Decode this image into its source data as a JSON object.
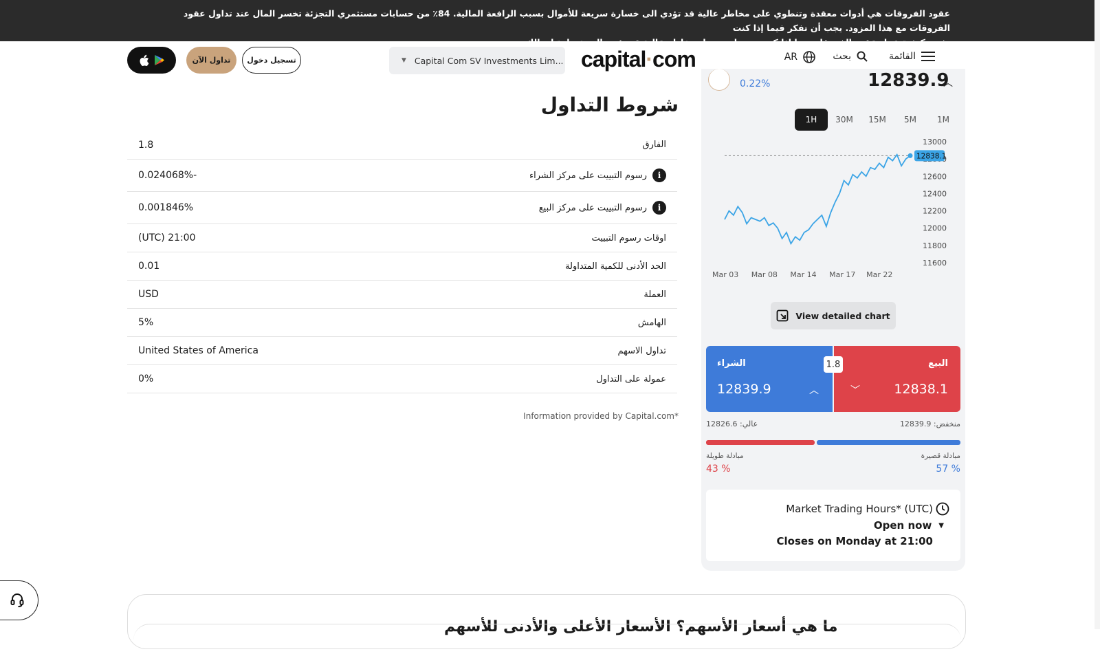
{
  "risk_banner": {
    "line1": "عقود الفروقات هي أدوات معقدة وتنطوي على مخاطر عالية قد تؤدي الى خسارة سريعة للأموال بسبب الرافعة المالية. 84٪ من حسابات مستثمري التجزئة تخسر المال عند تداول عقود الفروقات مع هذا المزود. يجب أن تفكر فيما إذا كنت",
    "line2": "تفهم كيفية عمل عقود الفروقات وما إذا كنت تستطيع تحمل مخاطر عالية قد تؤدي الى خسارة اموالك."
  },
  "nav": {
    "menu_label": "القائمة",
    "search_label": "بحث",
    "lang_label": "AR",
    "logo_left": "capital",
    "logo_dot": "·",
    "logo_right": "com",
    "entity_select": "Capital Com SV Investments Lim...",
    "login_label": "تسجيل دخول",
    "trade_now_label": "تداول الآن"
  },
  "terms": {
    "title": "شروط التداول",
    "rows": [
      {
        "label": "الفارق",
        "value": "1.8",
        "info": false
      },
      {
        "label": "رسوم التبييت على مركز الشراء",
        "value": "0.024068%-",
        "info": true
      },
      {
        "label": "رسوم التبييت على مركز البيع",
        "value": "0.001846%",
        "info": true
      },
      {
        "label": "اوقات رسوم التبييت",
        "value": "(UTC) 21:00",
        "info": false
      },
      {
        "label": "الحد الأدنى للكمية المتداولة",
        "value": "0.01",
        "info": false
      },
      {
        "label": "العملة",
        "value": "USD",
        "info": false
      },
      {
        "label": "الهامش",
        "value": "5%",
        "info": false
      },
      {
        "label": "تداول الاسهم",
        "value": "United States of America",
        "info": false
      },
      {
        "label": "عمولة على التداول",
        "value": "0%",
        "info": false
      }
    ],
    "note": "Information provided by Capital.com*"
  },
  "panel": {
    "change_pct": "0.22%",
    "price": "12839.9",
    "timeframes": [
      "1H",
      "30M",
      "15M",
      "5M",
      "1M"
    ],
    "active_timeframe": "1H",
    "detail_button": "View detailed chart",
    "buy_label": "الشراء",
    "buy_price": "12839.9",
    "sell_label": "البيع",
    "sell_price": "12838.1",
    "spread": "1.8",
    "high_text": "عالي: 12826.6",
    "low_text": "منخفض: 12839.9",
    "long_label": "مبادلة طويلة",
    "long_pct": "% 43",
    "short_label": "مبادلة قصيرة",
    "short_pct": "% 57",
    "hours_title": "Market Trading Hours* (UTC)",
    "hours_status": "Open now",
    "hours_close": "Closes on Monday at 21:00",
    "colors": {
      "buy": "#3e7bd9",
      "sell": "#de4349",
      "accent": "#c9a37c"
    }
  },
  "chart_data": {
    "type": "line",
    "x": [
      "Mar 03",
      "Mar 08",
      "Mar 14",
      "Mar 17",
      "Mar 22"
    ],
    "y_ticks": [
      13000,
      12800,
      12600,
      12400,
      12200,
      12000,
      11800,
      11600
    ],
    "ylim": [
      11600,
      13000
    ],
    "current_label": "12838.1",
    "values": [
      12100,
      12200,
      12150,
      12250,
      12180,
      12050,
      12120,
      12100,
      12080,
      12120,
      12030,
      12060,
      12000,
      11880,
      11950,
      11820,
      11900,
      11860,
      11950,
      11980,
      12050,
      12100,
      12150,
      12020,
      12180,
      12300,
      12400,
      12550,
      12500,
      12620,
      12580,
      12650,
      12600,
      12700,
      12680,
      12750,
      12700,
      12820,
      12780,
      12850,
      12720,
      12800,
      12838
    ]
  },
  "bottom": {
    "title": "ما هي أسعار الأسهم؟ الأسعار الأعلى والأدنى للأسهم"
  }
}
